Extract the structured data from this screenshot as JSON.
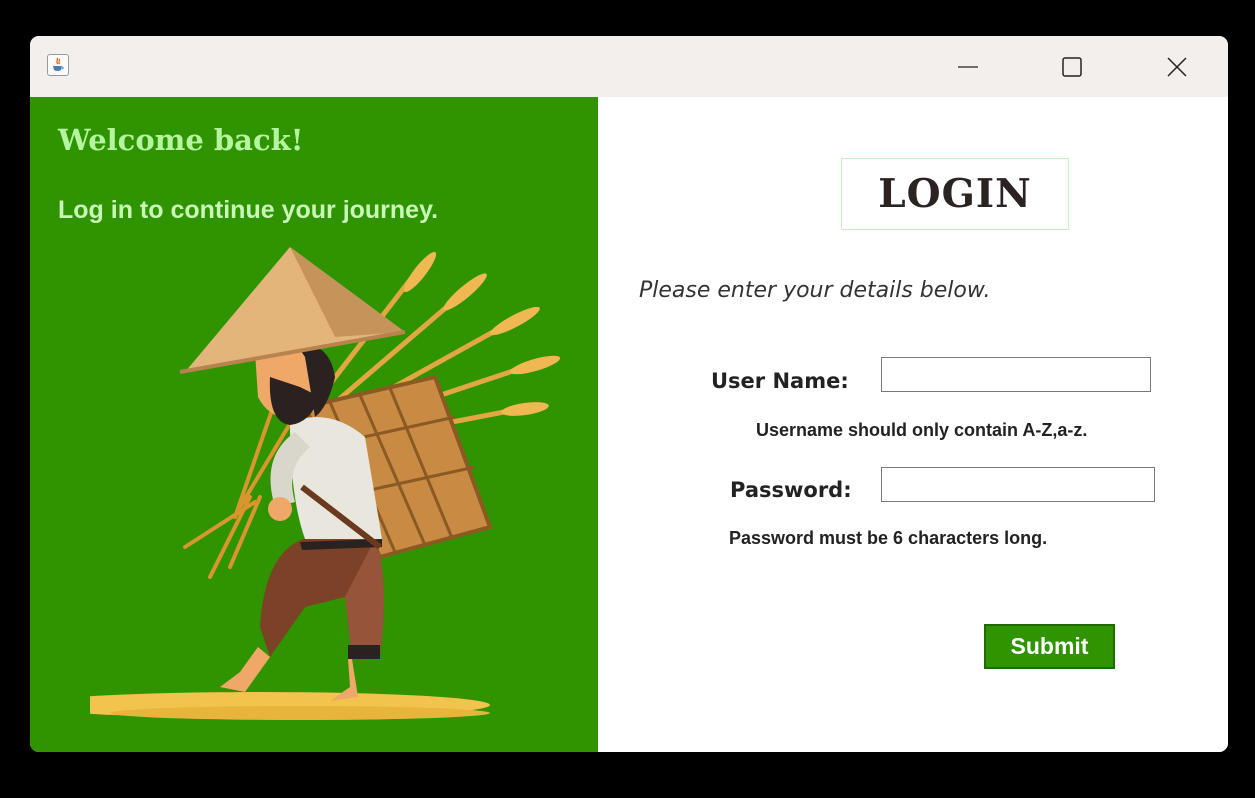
{
  "window": {
    "title": "",
    "controls": {
      "minimize": "minimize-icon",
      "maximize": "maximize-icon",
      "close": "close-icon"
    },
    "app_icon": "java-cup-icon"
  },
  "left_panel": {
    "background": "#2f9400",
    "heading": "Welcome back!",
    "subtitle": "Log in to continue your journey.",
    "illustration": "farmer-carrying-wheat-illustration"
  },
  "form": {
    "title": "LOGIN",
    "prompt": "Please enter your details below.",
    "username": {
      "label": "User Name:",
      "value": "",
      "hint": "Username should only contain A-Z,a-z."
    },
    "password": {
      "label": "Password:",
      "value": "",
      "hint": "Password must be 6 characters long."
    },
    "submit_label": "Submit",
    "accent": "#2f9400"
  }
}
